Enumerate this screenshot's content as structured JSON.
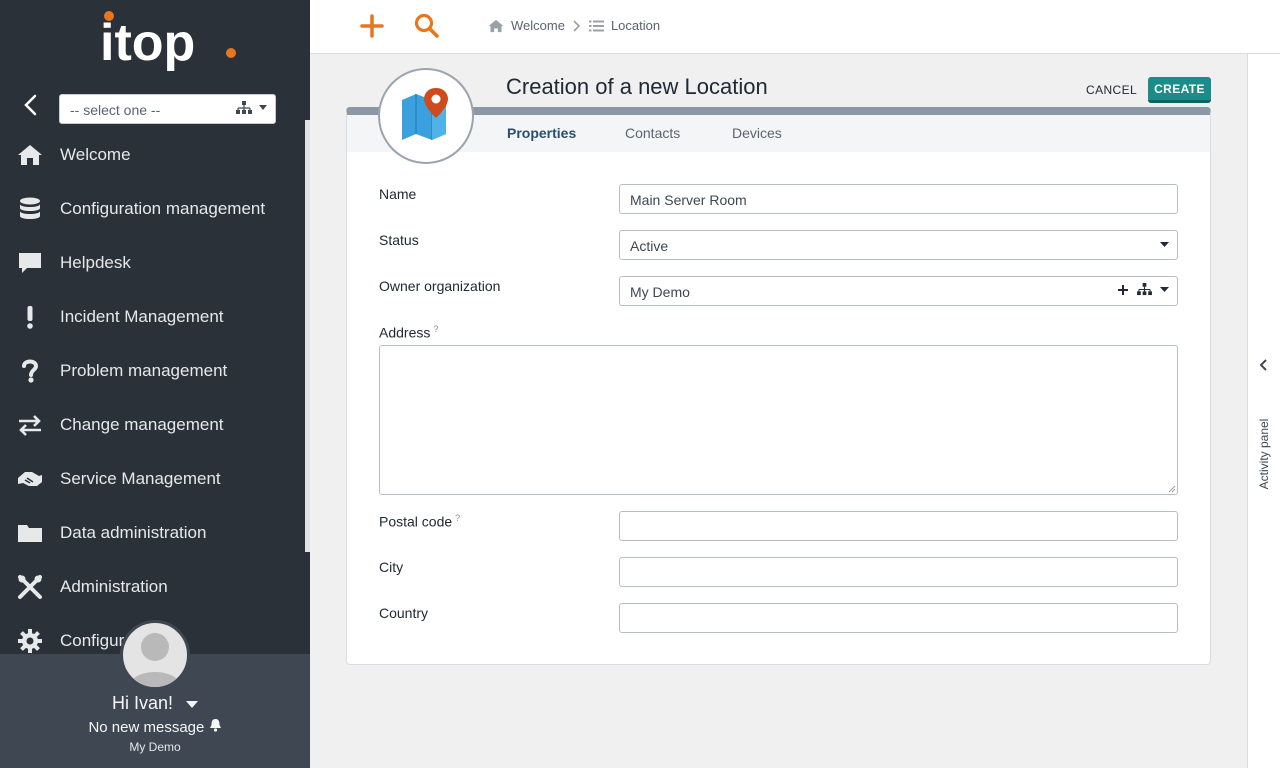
{
  "app": {
    "logo_text": "itop"
  },
  "sidebar": {
    "org_select": {
      "value": "-- select one --"
    },
    "items": [
      {
        "label": "Welcome",
        "icon": "home-icon"
      },
      {
        "label": "Configuration management",
        "icon": "database-icon"
      },
      {
        "label": "Helpdesk",
        "icon": "chat-bubble-icon"
      },
      {
        "label": "Incident Management",
        "icon": "exclamation-icon"
      },
      {
        "label": "Problem management",
        "icon": "question-icon"
      },
      {
        "label": "Change management",
        "icon": "exchange-arrows-icon"
      },
      {
        "label": "Service Management",
        "icon": "handshake-icon"
      },
      {
        "label": "Data administration",
        "icon": "folder-icon"
      },
      {
        "label": "Administration",
        "icon": "tools-icon"
      },
      {
        "label": "Configur",
        "icon": "gear-icon"
      }
    ]
  },
  "user": {
    "greeting": "Hi Ivan!",
    "messages": "No new message",
    "organization": "My Demo"
  },
  "topbar": {
    "breadcrumb": [
      {
        "label": "Welcome",
        "icon": "home-icon"
      },
      {
        "label": "Location",
        "icon": "list-icon"
      }
    ]
  },
  "form": {
    "title": "Creation of a new Location",
    "cancel_label": "CANCEL",
    "create_label": "CREATE",
    "tabs": [
      "Properties",
      "Contacts",
      "Devices"
    ],
    "fields": {
      "name": {
        "label": "Name",
        "value": "Main Server Room"
      },
      "status": {
        "label": "Status",
        "value": "Active"
      },
      "owner_org": {
        "label": "Owner organization",
        "value": "My Demo"
      },
      "address": {
        "label": "Address",
        "help": "?",
        "value": ""
      },
      "postal_code": {
        "label": "Postal code",
        "help": "?",
        "value": ""
      },
      "city": {
        "label": "City",
        "value": ""
      },
      "country": {
        "label": "Country",
        "value": ""
      }
    }
  },
  "activity_panel": {
    "label": "Activity panel"
  },
  "colors": {
    "accent": "#e8761c",
    "sidebar": "#2b3138",
    "primary_button": "#1a8c8a"
  }
}
